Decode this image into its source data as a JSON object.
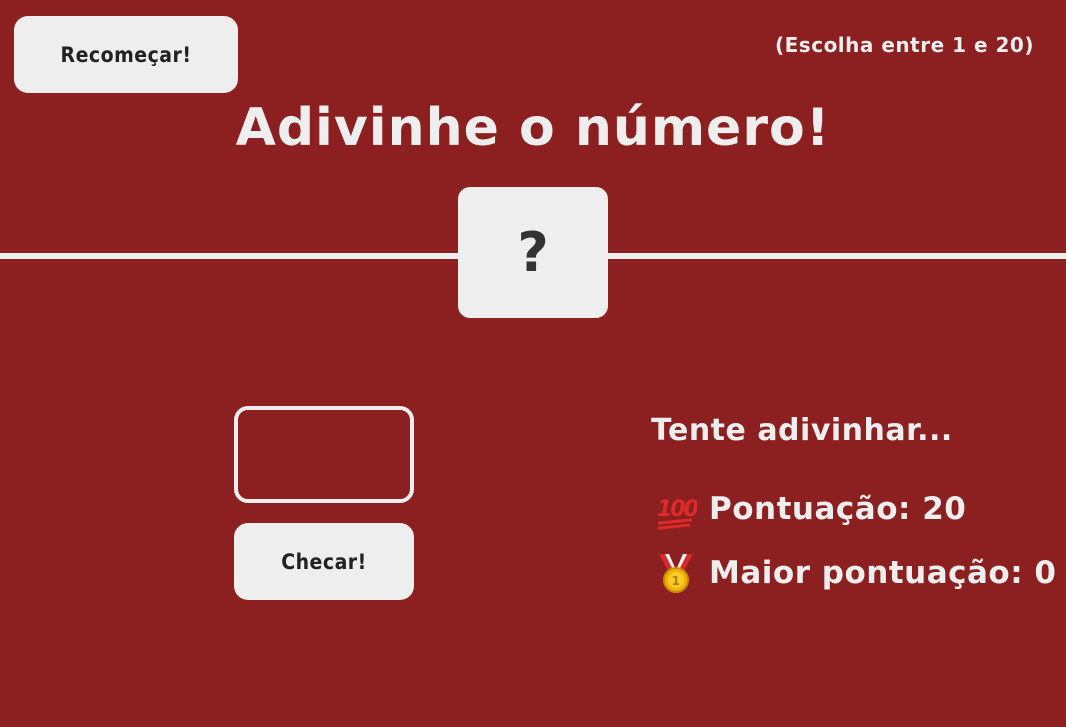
{
  "header": {
    "again_label": "Recomeçar!",
    "between_text": "(Escolha entre 1 e 20)",
    "title": "Adivinhe o número!",
    "secret_number": "?"
  },
  "controls": {
    "guess_value": "",
    "check_label": "Checar!"
  },
  "stats": {
    "message": "Tente adivinhar...",
    "score_label": "Pontuação:",
    "score_value": "20",
    "score_icon": "hundred-points-icon",
    "highscore_label": "Maior pontuação:",
    "highscore_value": "0",
    "highscore_icon": "medal-icon"
  },
  "colors": {
    "background": "#8c1f1f",
    "foreground": "#eeeeee",
    "button_text": "#222222"
  }
}
